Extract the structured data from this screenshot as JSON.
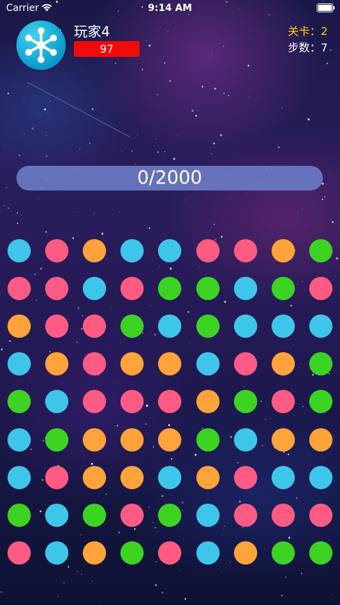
{
  "status_bar": {
    "carrier": "Carrier",
    "time": "9:14 AM"
  },
  "player": {
    "name": "玩家4",
    "score": "97",
    "avatar_icon": "snowflake-network-icon"
  },
  "stats": {
    "level_label": "关卡：",
    "level_value": "2",
    "steps_label": "步数：",
    "steps_value": "7"
  },
  "progress": {
    "text": "0/2000",
    "value": 0,
    "target": 2000
  },
  "colors": {
    "blue": "#3ec6ea",
    "pink": "#fd5b84",
    "orange": "#ffa33a",
    "green": "#3dd323"
  },
  "grid": [
    [
      "blue",
      "pink",
      "orange",
      "blue",
      "blue",
      "pink",
      "pink",
      "orange",
      "green"
    ],
    [
      "pink",
      "pink",
      "blue",
      "pink",
      "green",
      "green",
      "blue",
      "green",
      "pink"
    ],
    [
      "orange",
      "pink",
      "pink",
      "green",
      "blue",
      "green",
      "blue",
      "blue",
      "blue"
    ],
    [
      "blue",
      "orange",
      "pink",
      "orange",
      "orange",
      "blue",
      "pink",
      "orange",
      "green"
    ],
    [
      "green",
      "blue",
      "pink",
      "pink",
      "pink",
      "orange",
      "green",
      "pink",
      "green"
    ],
    [
      "blue",
      "green",
      "orange",
      "orange",
      "orange",
      "green",
      "blue",
      "orange",
      "orange"
    ],
    [
      "blue",
      "pink",
      "orange",
      "orange",
      "blue",
      "orange",
      "pink",
      "blue",
      "blue"
    ],
    [
      "green",
      "blue",
      "green",
      "pink",
      "green",
      "blue",
      "pink",
      "pink",
      "pink"
    ],
    [
      "pink",
      "blue",
      "orange",
      "green",
      "pink",
      "blue",
      "orange",
      "green",
      "green"
    ]
  ]
}
